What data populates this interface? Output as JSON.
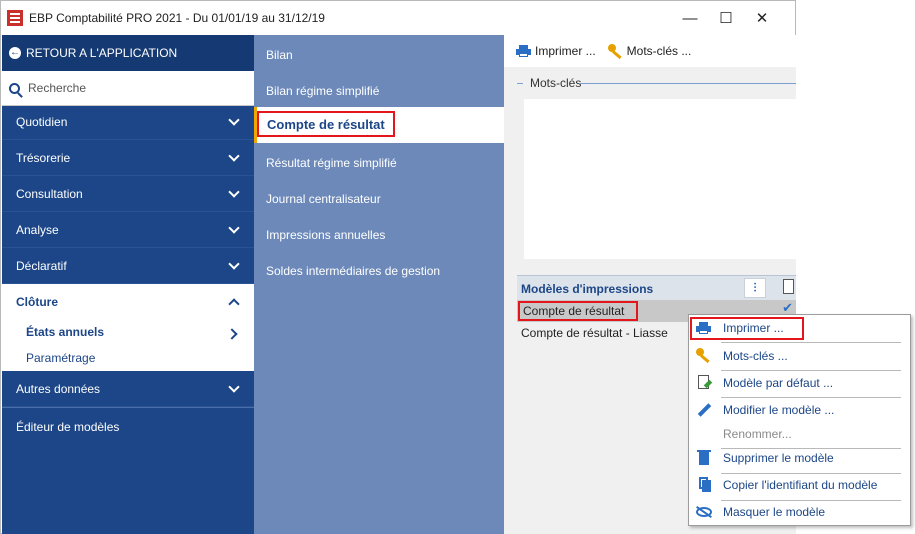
{
  "window": {
    "title": "EBP Comptabilité PRO 2021 - Du 01/01/19 au 31/12/19",
    "minimize": "—",
    "maximize": "☐",
    "close": "✕"
  },
  "sidebar": {
    "back_label": "RETOUR A L'APPLICATION",
    "search_placeholder": "Recherche",
    "items": [
      {
        "label": "Quotidien"
      },
      {
        "label": "Trésorerie"
      },
      {
        "label": "Consultation"
      },
      {
        "label": "Analyse"
      },
      {
        "label": "Déclaratif"
      }
    ],
    "cloture": {
      "label": "Clôture",
      "sub_active": "États annuels",
      "sub_other": "Paramétrage"
    },
    "other_label": "Autres données",
    "editor_label": "Éditeur de modèles"
  },
  "middle": {
    "items": [
      "Bilan",
      "Bilan régime simplifié",
      "Compte de résultat",
      "Résultat régime simplifié",
      "Journal centralisateur",
      "Impressions annuelles",
      "Soldes intermédiaires de gestion"
    ],
    "selected_index": 2
  },
  "toolbar": {
    "print_label": "Imprimer ...",
    "keywords_label": "Mots-clés ..."
  },
  "keywords": {
    "group_label": "Mots-clés"
  },
  "models": {
    "title": "Modèles d'impressions",
    "settings_icon_glyph": "⫶",
    "rows": [
      {
        "label": "Compte de résultat",
        "selected": true,
        "check": "✔"
      },
      {
        "label": "Compte de résultat - Liasse",
        "selected": false
      }
    ]
  },
  "context_menu": {
    "items": [
      {
        "label": "Imprimer ...",
        "icon": "printer-icon"
      },
      {
        "label": "Mots-clés ...",
        "icon": "key-icon"
      },
      {
        "label": "Modèle par défaut ...",
        "icon": "document-check-icon"
      },
      {
        "label": "Modifier le modèle ...",
        "icon": "pencil-icon"
      },
      {
        "label": "Renommer...",
        "icon": "none",
        "disabled": true
      },
      {
        "label": "Supprimer le modèle",
        "icon": "trash-icon"
      },
      {
        "label": "Copier l'identifiant du modèle",
        "icon": "copy-icon"
      },
      {
        "label": "Masquer le modèle",
        "icon": "eye-slash-icon"
      }
    ]
  },
  "colors": {
    "sidebar": "#1c4687",
    "middle": "#6c89b9",
    "highlight_border": "#e3161b",
    "accent": "#2b6fc4"
  }
}
